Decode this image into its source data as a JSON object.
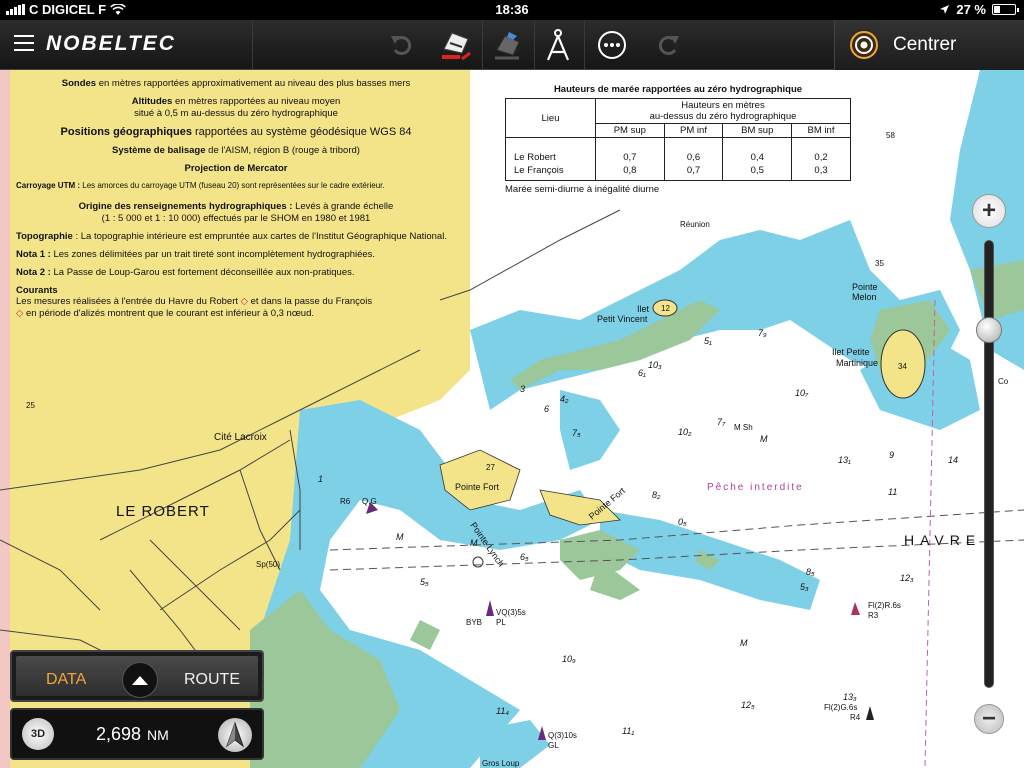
{
  "status_bar": {
    "carrier": "C DIGICEL F",
    "time": "18:36",
    "battery_percent": "27 %",
    "battery_level": 0.27
  },
  "toolbar": {
    "brand": "NOBELTEC",
    "centrer_label": "Centrer",
    "icons": [
      "menu-icon",
      "undo-icon",
      "boat-track-icon",
      "boat-icon",
      "compass-divider-icon",
      "more-icon",
      "redo-icon",
      "target-icon"
    ],
    "accent_color": "#f2a43a"
  },
  "chart_notes": {
    "line1_bold": "Sondes",
    "line1": " en mètres rapportées approximativement au niveau des plus basses mers",
    "line2_bold": "Altitudes",
    "line2": " en mètres rapportées au niveau moyen",
    "line2b": "situé à 0,5 m au-dessus du zéro hydrographique",
    "line3_bold": "Positions géographiques",
    "line3": " rapportées au système géodésique WGS 84",
    "line4_bold": "Système de balisage",
    "line4": " de l'AISM, région B (rouge à tribord)",
    "line5": "Projection de Mercator",
    "line6_bold": "Carroyage UTM :",
    "line6": " Les amorces du carroyage UTM (fuseau 20) sont représentées sur le cadre extérieur.",
    "line7_bold": "Origine des renseignements hydrographiques :",
    "line7": " Levés à grande échelle",
    "line7b": "(1 : 5 000 et 1 : 10 000) effectués par le SHOM en 1980 et 1981",
    "line8_bold": "Topographie",
    "line8": " : La topographie intérieure est empruntée aux cartes de l'Institut Géographique National.",
    "line9_bold": "Nota 1 :",
    "line9": " Les zones délimitées par un trait tireté sont incomplètement hydrographiées.",
    "line10_bold": "Nota 2 :",
    "line10": " La Passe de Loup-Garou est fortement déconseillée aux non-pratiques.",
    "line11_bold": "Courants",
    "line11": "Les mesures réalisées à l'entrée du Havre du Robert",
    "line11b": "et dans la passe du François",
    "line11c": "en période d'alizés montrent que le courant est inférieur à 0,3 nœud."
  },
  "tide_table": {
    "title": "Hauteurs de marée rapportées au zéro hydrographique",
    "col_lieu": "Lieu",
    "col_group": "Hauteurs en mètres",
    "col_group2": "au-dessus du zéro hydrographique",
    "headers": [
      "PM sup",
      "PM inf",
      "BM sup",
      "BM inf"
    ],
    "rows": [
      {
        "lieu": "Le Robert",
        "values": [
          "0,7",
          "0,6",
          "0,4",
          "0,2"
        ]
      },
      {
        "lieu": "Le François",
        "values": [
          "0,8",
          "0,7",
          "0,5",
          "0,3"
        ]
      }
    ],
    "note": "Marée semi-diurne à inégalité diurne"
  },
  "map_labels": {
    "le_robert": "LE ROBERT",
    "cite_lacroix": "Cité Lacroix",
    "pointe_fort": "Pointe Fort",
    "pointe_fort2": "Pointe Fort",
    "pointe_lynch": "Pointe Lynch",
    "petit_vincent": "Petit Vincent",
    "ilet": "Ilet",
    "ilet_petite": "Ilet Petite",
    "martinique": "Martinique",
    "pointe_melon": "Pointe",
    "pointe_melon2": "Melon",
    "reunion": "Réunion",
    "peche": "Pêche interdite",
    "havre": "HAVRE",
    "gros_loup": "Gros Loup",
    "light1": "Fl(2)R.6s",
    "light1b": "R3",
    "light2": "Fl(2)G.6s",
    "light2b": "R4",
    "light3": "VQ(3)5s",
    "light3b": "BYB",
    "light4": "Q(3)10s",
    "light4b": "GL",
    "light5": "Q.G",
    "light5b": "R6",
    "sp50": "Sp(50)",
    "pl": "PL",
    "sh": "M Sh",
    "co": "Co",
    "twelve": "12",
    "thirtyfour": "34",
    "thirtyfive": "35",
    "twentyseven": "27",
    "fiftyeight": "58",
    "twentyfive": "25",
    "depths": [
      "10₃",
      "10₇",
      "10₂",
      "13₁",
      "14",
      "9",
      "11",
      "0₅",
      "6₅",
      "5₅",
      "8₂",
      "7₇",
      "12₃",
      "11₄",
      "10₉",
      "12₅",
      "11₁",
      "13₃",
      "5₃",
      "8₅",
      "7₉",
      "5₁",
      "6₁",
      "4₂",
      "7₅",
      "6",
      "3",
      "1",
      "M",
      "M",
      "M",
      "M"
    ]
  },
  "zoom": {
    "in_label": "+",
    "out_label": "−",
    "level": 0.2
  },
  "data_route": {
    "data_label": "DATA",
    "route_label": "ROUTE"
  },
  "nav_panel": {
    "view_label": "3D",
    "distance_value": "2,698",
    "distance_unit": "NM"
  }
}
